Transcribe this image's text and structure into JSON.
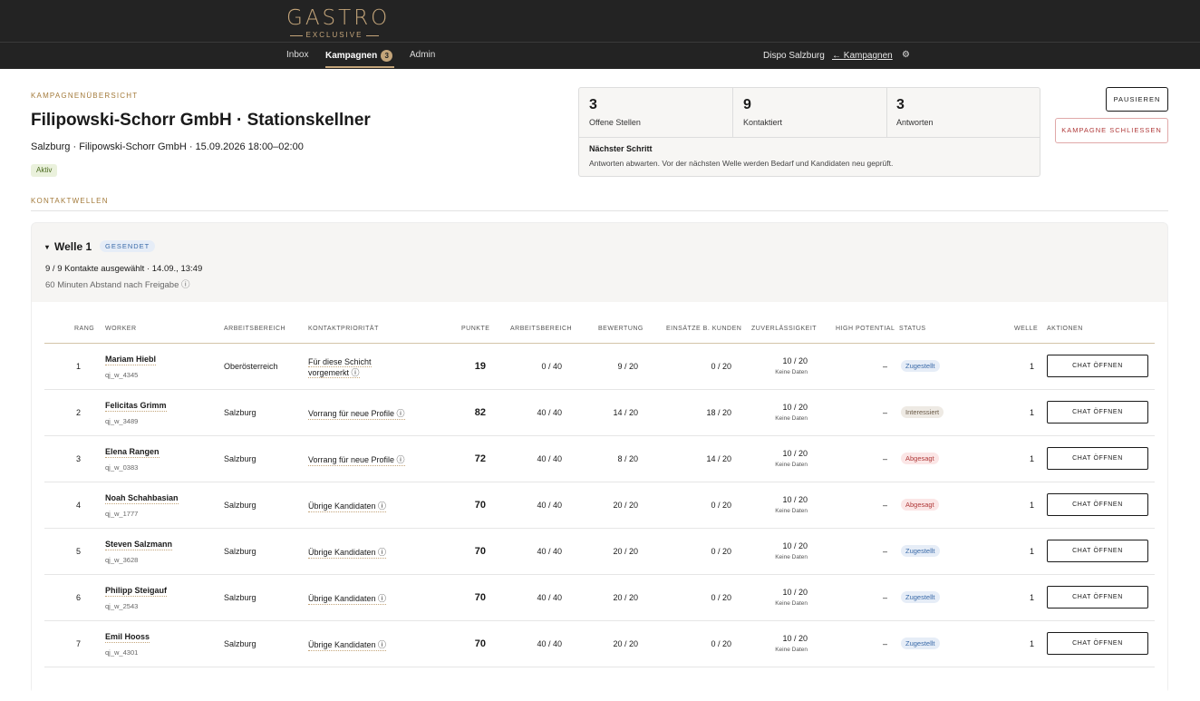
{
  "brand": {
    "main": "GASTRO",
    "sub": "EXCLUSIVE"
  },
  "nav": {
    "inbox": "Inbox",
    "kampagnen": "Kampagnen",
    "kampagnen_count": "3",
    "admin": "Admin",
    "dispo": "Dispo Salzburg",
    "back": "← Kampagnen",
    "settings_icon": "⚙"
  },
  "header": {
    "eyebrow": "KAMPAGNENÜBERSICHT",
    "title": "Filipowski-Schorr GmbH · Stationskellner",
    "subline": "Salzburg · Filipowski-Schorr GmbH · 15.09.2026 18:00–02:00",
    "status": "Aktiv"
  },
  "stats": [
    {
      "value": "3",
      "label": "Offene Stellen"
    },
    {
      "value": "9",
      "label": "Kontaktiert"
    },
    {
      "value": "3",
      "label": "Antworten"
    }
  ],
  "next_step": {
    "title": "Nächster Schritt",
    "text": "Antworten abwarten. Vor der nächsten Welle werden Bedarf und Kandidaten neu geprüft."
  },
  "actions": {
    "pause": "PAUSIEREN",
    "close": "KAMPAGNE SCHLIESSEN"
  },
  "waves_label": "KONTAKTWELLEN",
  "wave": {
    "title": "Welle 1",
    "status": "GESENDET",
    "meta1": "9 / 9 Kontakte ausgewählt · 14.09., 13:49",
    "meta2": "60 Minuten Abstand nach Freigabe ⓘ"
  },
  "columns": {
    "rang": "RANG",
    "worker": "WORKER",
    "arbeitsbereich": "ARBEITSBEREICH",
    "kontaktprioritaet": "KONTAKTPRIORITÄT",
    "punkte": "PUNKTE",
    "arbeitsbereich2": "ARBEITSBEREICH",
    "bewertung": "BEWERTUNG",
    "einsaetze": "EINSÄTZE B. KUNDEN",
    "zuverlaessigkeit": "ZUVERLÄSSIGKEIT",
    "high_potential": "HIGH POTENTIAL",
    "status": "STATUS",
    "welle": "WELLE",
    "aktionen": "AKTIONEN"
  },
  "rows": [
    {
      "rank": "1",
      "name": "Mariam Hiebl",
      "id": "qj_w_4345",
      "area": "Oberösterreich",
      "prio_a": "Für diese Schicht",
      "prio_b": "vorgemerkt ⓘ",
      "points": "19",
      "ab": "0 / 40",
      "bew": "9 / 20",
      "eins": "0 / 20",
      "zuv": "10 / 20",
      "zuv_sub": "Keine Daten",
      "hp": "–",
      "status": "Zugestellt",
      "welle": "1",
      "chat": "CHAT ÖFFNEN"
    },
    {
      "rank": "2",
      "name": "Felicitas Grimm",
      "id": "qj_w_3489",
      "area": "Salzburg",
      "prio": "Vorrang für neue Profile ⓘ",
      "points": "82",
      "ab": "40 / 40",
      "bew": "14 / 20",
      "eins": "18 / 20",
      "zuv": "10 / 20",
      "zuv_sub": "Keine Daten",
      "hp": "–",
      "status": "Interessiert",
      "welle": "1",
      "chat": "CHAT ÖFFNEN"
    },
    {
      "rank": "3",
      "name": "Elena Rangen",
      "id": "qj_w_0383",
      "area": "Salzburg",
      "prio": "Vorrang für neue Profile ⓘ",
      "points": "72",
      "ab": "40 / 40",
      "bew": "8 / 20",
      "eins": "14 / 20",
      "zuv": "10 / 20",
      "zuv_sub": "Keine Daten",
      "hp": "–",
      "status": "Abgesagt",
      "welle": "1",
      "chat": "CHAT ÖFFNEN"
    },
    {
      "rank": "4",
      "name": "Noah Schahbasian",
      "id": "qj_w_1777",
      "area": "Salzburg",
      "prio": "Übrige Kandidaten ⓘ",
      "points": "70",
      "ab": "40 / 40",
      "bew": "20 / 20",
      "eins": "0 / 20",
      "zuv": "10 / 20",
      "zuv_sub": "Keine Daten",
      "hp": "–",
      "status": "Abgesagt",
      "welle": "1",
      "chat": "CHAT ÖFFNEN"
    },
    {
      "rank": "5",
      "name": "Steven Salzmann",
      "id": "qj_w_3628",
      "area": "Salzburg",
      "prio": "Übrige Kandidaten ⓘ",
      "points": "70",
      "ab": "40 / 40",
      "bew": "20 / 20",
      "eins": "0 / 20",
      "zuv": "10 / 20",
      "zuv_sub": "Keine Daten",
      "hp": "–",
      "status": "Zugestellt",
      "welle": "1",
      "chat": "CHAT ÖFFNEN"
    },
    {
      "rank": "6",
      "name": "Philipp Steigauf",
      "id": "qj_w_2543",
      "area": "Salzburg",
      "prio": "Übrige Kandidaten ⓘ",
      "points": "70",
      "ab": "40 / 40",
      "bew": "20 / 20",
      "eins": "0 / 20",
      "zuv": "10 / 20",
      "zuv_sub": "Keine Daten",
      "hp": "–",
      "status": "Zugestellt",
      "welle": "1",
      "chat": "CHAT ÖFFNEN"
    },
    {
      "rank": "7",
      "name": "Emil Hooss",
      "id": "qj_w_4301",
      "area": "Salzburg",
      "prio": "Übrige Kandidaten ⓘ",
      "points": "70",
      "ab": "40 / 40",
      "bew": "20 / 20",
      "eins": "0 / 20",
      "zuv": "10 / 20",
      "zuv_sub": "Keine Daten",
      "hp": "–",
      "status": "Zugestellt",
      "welle": "1",
      "chat": "CHAT ÖFFNEN"
    }
  ]
}
